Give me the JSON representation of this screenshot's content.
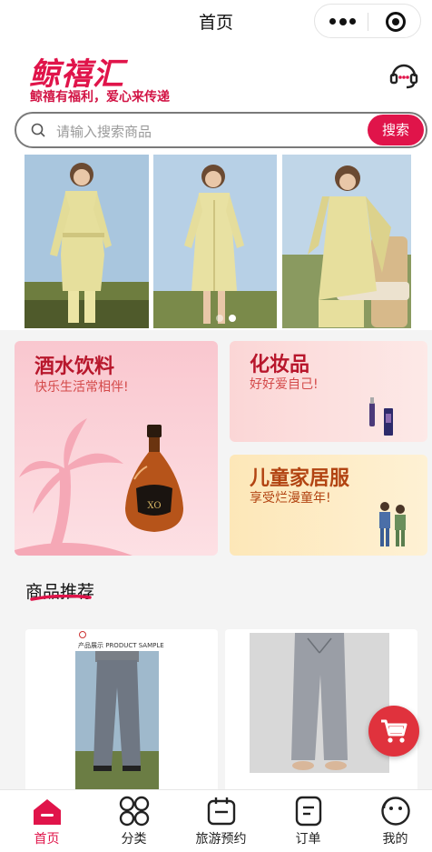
{
  "nav": {
    "title": "首页"
  },
  "header": {
    "logo": "鲸禧汇",
    "slogan": "鲸禧有福利，爱心来传递",
    "search_placeholder": "请输入搜索商品",
    "search_button": "搜索"
  },
  "banner": {
    "slide_count": 2,
    "active_index": 1
  },
  "categories": [
    {
      "title": "酒水饮料",
      "subtitle": "快乐生活常相伴!",
      "product_label": "XO"
    },
    {
      "title": "化妆品",
      "subtitle": "好好爱自己!"
    },
    {
      "title": "儿童家居服",
      "subtitle": "享受烂漫童年!"
    }
  ],
  "section": {
    "title": "商品推荐"
  },
  "products": [
    {
      "tag": "产品展示 PRODUCT SAMPLE"
    },
    {
      "tag": ""
    }
  ],
  "tabbar": {
    "items": [
      {
        "label": "首页",
        "icon": "home-icon",
        "active": true
      },
      {
        "label": "分类",
        "icon": "category-icon",
        "active": false
      },
      {
        "label": "旅游预约",
        "icon": "calendar-icon",
        "active": false
      },
      {
        "label": "订单",
        "icon": "order-icon",
        "active": false
      },
      {
        "label": "我的",
        "icon": "profile-icon",
        "active": false
      }
    ]
  },
  "colors": {
    "brand": "#e0144a",
    "cart": "#e0323d"
  }
}
